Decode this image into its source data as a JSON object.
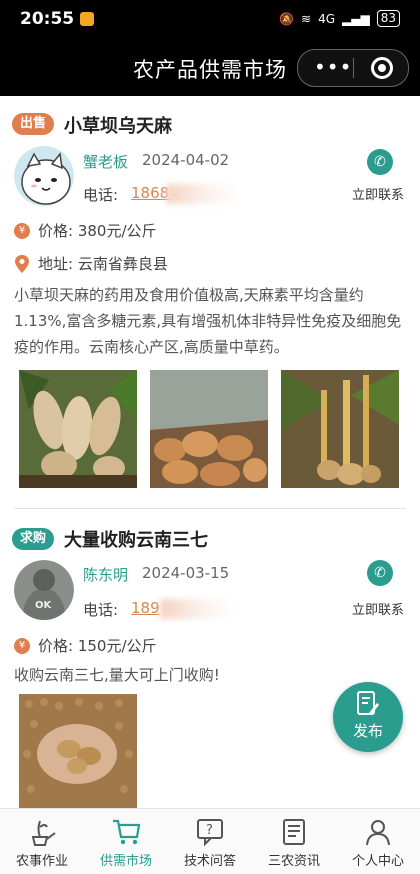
{
  "status_bar": {
    "time": "20:55",
    "network": "4G",
    "battery": "83"
  },
  "nav": {
    "title": "农产品供需市场",
    "more_icon": "•••"
  },
  "listings": [
    {
      "tag": "出售",
      "title": "小草坝乌天麻",
      "user": "蟹老板",
      "date": "2024-04-02",
      "phone_label": "电话:",
      "phone": "1868",
      "call_label": "立即联系",
      "price": "价格: 380元/公斤",
      "address": "地址: 云南省彝良县",
      "description": "小草坝天麻的药用及食用价值极高,天麻素平均含量约1.13%,富含多糖元素,具有增强机体非特异性免疫及细胞免疫的作用。云南核心产区,高质量中草药。"
    },
    {
      "tag": "求购",
      "title": "大量收购云南三七",
      "user": "陈东明",
      "date": "2024-03-15",
      "phone_label": "电话:",
      "phone": "189",
      "call_label": "立即联系",
      "price": "价格: 150元/公斤",
      "description": "收购云南三七,量大可上门收购!"
    }
  ],
  "fab": {
    "label": "发布"
  },
  "tabs": [
    {
      "label": "农事作业"
    },
    {
      "label": "供需市场"
    },
    {
      "label": "技术问答"
    },
    {
      "label": "三农资讯"
    },
    {
      "label": "个人中心"
    }
  ],
  "colors": {
    "accent": "#2a9d8f",
    "sell_tag": "#e07e4e",
    "phone": "#d9864f"
  }
}
